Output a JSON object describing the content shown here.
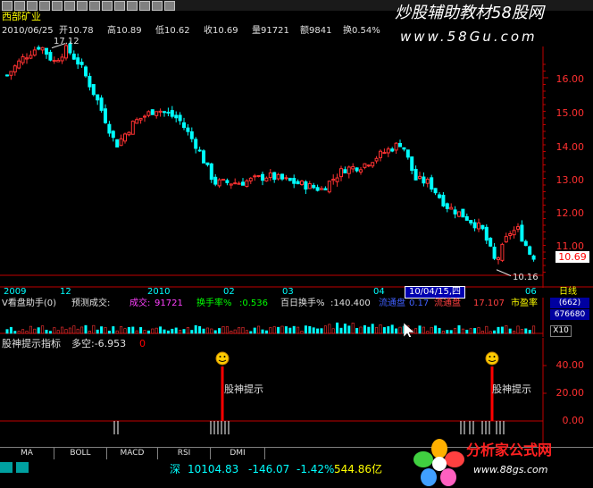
{
  "header": {
    "stock_name": "西部矿业",
    "date": "2010/06/25",
    "open": "开10.78",
    "high": "高10.89",
    "low": "低10.62",
    "close": "收10.69",
    "volume": "量91721",
    "amount": "额9841",
    "turnover": "换0.54%"
  },
  "watermark": {
    "title": "炒股辅助教材58股网",
    "url": "www.58Gu.com"
  },
  "main_chart": {
    "y_labels": [
      "16.00",
      "15.00",
      "14.00",
      "13.00",
      "12.00",
      "11.00"
    ],
    "current_price": "10.69",
    "high_marker": "17.12",
    "low_marker": "10.16",
    "up_color": "#ff3232",
    "down_color": "#00ffff"
  },
  "time_axis": {
    "labels": [
      "2009",
      "12",
      "2010",
      "02",
      "03",
      "04",
      "06"
    ],
    "cursor_label": "10/04/15,四",
    "right_label": "日线"
  },
  "volume_panel": {
    "title": "V看盘助手(0)",
    "forecast": "预测成交:",
    "deal_label": "成交:",
    "deal_value": "91721",
    "turnover_label": "换手率%",
    "turnover_value": ":0.536",
    "hundred_label": "百日换手%",
    "hundred_value": ":140.400",
    "float_label": "流通盘",
    "float_value": "0.17",
    "float2_label": "流通盘",
    "float2_value": "17.107",
    "pe_label": "市盈率",
    "right_top": "(662)",
    "right_mid": "676680",
    "right_bot": "X10"
  },
  "indicator": {
    "title": "股神提示指标",
    "duokong": "多空:-6.953",
    "tail": "0",
    "signal_text": "股神提示",
    "y_labels": [
      "40.00",
      "20.00",
      "0.00"
    ]
  },
  "tabs": [
    {
      "label": "MA"
    },
    {
      "label": "BOLL"
    },
    {
      "label": "MACD"
    },
    {
      "label": "RSI"
    },
    {
      "label": "DMI"
    }
  ],
  "status": {
    "index_name": "深",
    "index_value": "10104.83",
    "change": "-146.07",
    "change_pct": "-1.42%",
    "amount": "544.86亿"
  },
  "logo": {
    "name": "分析家公式网",
    "url": "www.88gs.com"
  }
}
